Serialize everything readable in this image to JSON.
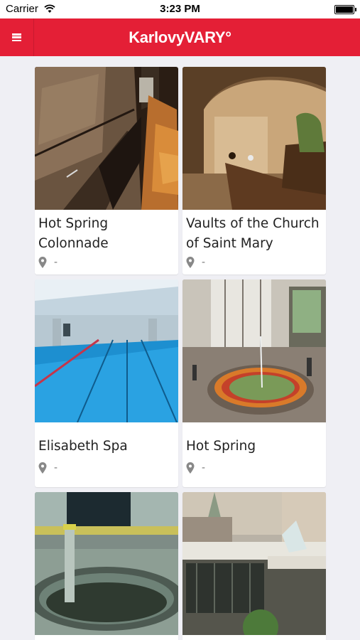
{
  "status": {
    "carrier": "Carrier",
    "time": "3:23 PM"
  },
  "nav": {
    "logo": "KarlovyVARY°"
  },
  "cards": [
    {
      "title": "Hot Spring Colonnade",
      "location": "-"
    },
    {
      "title": "Vaults of the Church of Saint Mary",
      "location": "-"
    },
    {
      "title": "Elisabeth Spa",
      "location": "-"
    },
    {
      "title": "Hot Spring",
      "location": "-"
    },
    {
      "title": "",
      "location": ""
    },
    {
      "title": "",
      "location": ""
    }
  ],
  "colors": {
    "brand_red": "#e41f36",
    "background": "#efeff4"
  },
  "icons": {
    "menu": "hamburger-icon",
    "location": "location-pin-icon",
    "wifi": "wifi-icon",
    "battery": "battery-icon"
  }
}
